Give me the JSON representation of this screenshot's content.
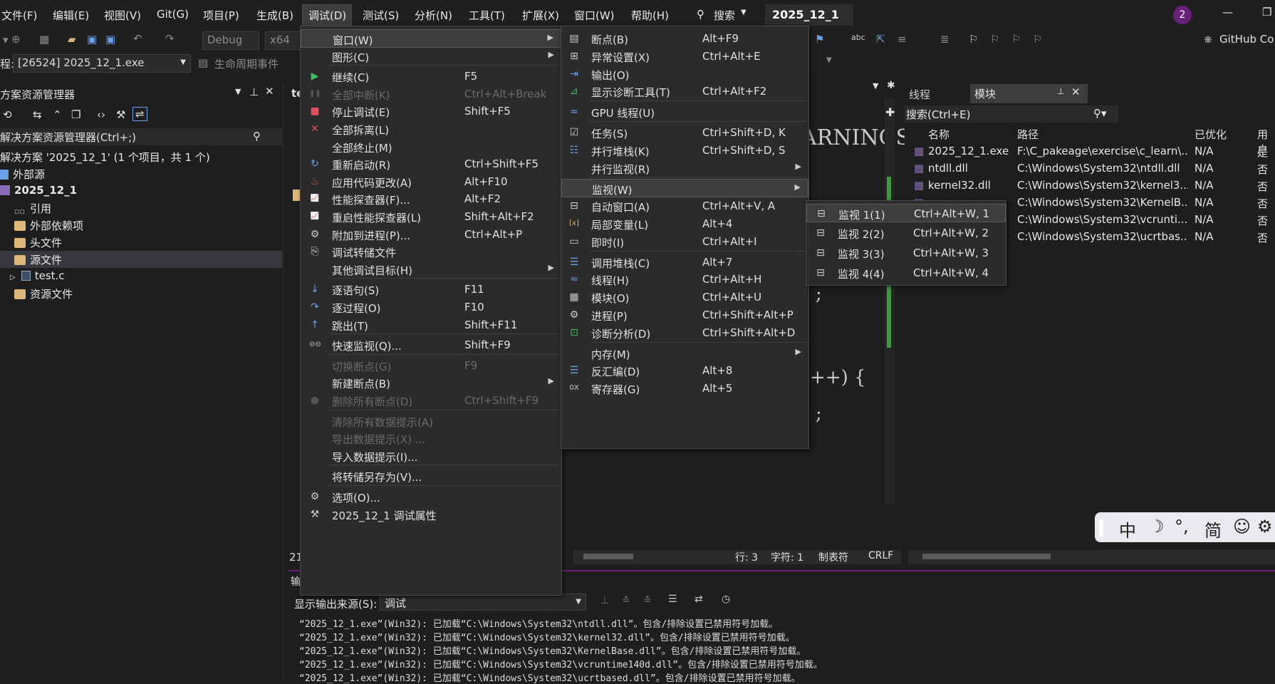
{
  "menubar": {
    "items": [
      "文件(F)",
      "编辑(E)",
      "视图(V)",
      "Git(G)",
      "项目(P)",
      "生成(B)",
      "调试(D)",
      "测试(S)",
      "分析(N)",
      "工具(T)",
      "扩展(X)",
      "窗口(W)",
      "帮助(H)"
    ],
    "search": "搜索",
    "project_title": "2025_12_1",
    "notification_count": "2"
  },
  "toolbar": {
    "config": "Debug",
    "platform": "x64",
    "github": "GitHub Co"
  },
  "toolbar2": {
    "process_label": "程:",
    "process": "[26524] 2025_12_1.exe",
    "lifecycle": "生命周期事件"
  },
  "solution_explorer": {
    "title": "方案资源管理器",
    "search_placeholder": "解决方案资源管理器(Ctrl+;)",
    "items": [
      {
        "label": "解决方案 '2025_12_1' (1 个项目，共 1 个)",
        "indent": 0
      },
      {
        "label": "外部源",
        "indent": 0
      },
      {
        "label": "2025_12_1",
        "indent": 0,
        "bold": true
      },
      {
        "label": "引用",
        "indent": 1
      },
      {
        "label": "外部依赖项",
        "indent": 1
      },
      {
        "label": "头文件",
        "indent": 1
      },
      {
        "label": "源文件",
        "indent": 1,
        "selected": true
      },
      {
        "label": "test.c",
        "indent": 2
      },
      {
        "label": "资源文件",
        "indent": 1
      }
    ]
  },
  "editor": {
    "code_fragments": [
      "ARNINGS",
      ";",
      "++)  {",
      ";"
    ],
    "line_number": "21",
    "tab_fragment": "te"
  },
  "status": {
    "line": "行: 3",
    "char": "字符: 1",
    "tab": "制表符",
    "eol": "CRLF"
  },
  "right_panel": {
    "tabs": [
      "线程",
      "模块"
    ],
    "search_placeholder": "搜索(Ctrl+E)",
    "columns": [
      "名称",
      "路径",
      "已优化",
      "用户"
    ],
    "rows": [
      {
        "name": "2025_12_1.exe",
        "path": "F:\\C_pakeage\\exercise\\c_learn\\...",
        "opt": "N/A",
        "user": "是"
      },
      {
        "name": "ntdll.dll",
        "path": "C:\\Windows\\System32\\ntdll.dll",
        "opt": "N/A",
        "user": "否"
      },
      {
        "name": "kernel32.dll",
        "path": "C:\\Windows\\System32\\kernel3...",
        "opt": "N/A",
        "user": "否"
      },
      {
        "name": "",
        "path": "C:\\Windows\\System32\\KernelB...",
        "opt": "N/A",
        "user": "否"
      },
      {
        "name": "",
        "path": "C:\\Windows\\System32\\vcrunti...",
        "opt": "N/A",
        "user": "否"
      },
      {
        "name": "",
        "path": "C:\\Windows\\System32\\ucrtbas...",
        "opt": "N/A",
        "user": "否"
      }
    ]
  },
  "output": {
    "tab": "输",
    "source_label": "显示输出来源(S):",
    "source_value": "调试",
    "lines": [
      "“2025_12_1.exe”(Win32): 已加载“C:\\Windows\\System32\\ntdll.dll”。包含/排除设置已禁用符号加载。",
      "“2025_12_1.exe”(Win32): 已加载“C:\\Windows\\System32\\kernel32.dll”。包含/排除设置已禁用符号加载。",
      "“2025_12_1.exe”(Win32): 已加载“C:\\Windows\\System32\\KernelBase.dll”。包含/排除设置已禁用符号加载。",
      "“2025_12_1.exe”(Win32): 已加载“C:\\Windows\\System32\\vcruntime140d.dll”。包含/排除设置已禁用符号加载。",
      "“2025_12_1.exe”(Win32): 已加载“C:\\Windows\\System32\\ucrtbased.dll”。包含/排除设置已禁用符号加载。"
    ]
  },
  "debug_menu": [
    {
      "label": "窗口(W)",
      "sc": "",
      "sub": true,
      "icon": "",
      "hl": true
    },
    {
      "label": "图形(C)",
      "sc": "",
      "sub": true,
      "icon": ""
    },
    {
      "sep": true
    },
    {
      "label": "继续(C)",
      "sc": "F5",
      "icon": "play-icon"
    },
    {
      "label": "全部中断(K)",
      "sc": "Ctrl+Alt+Break",
      "icon": "pause-icon",
      "dis": true
    },
    {
      "label": "停止调试(E)",
      "sc": "Shift+F5",
      "icon": "stop-icon"
    },
    {
      "label": "全部拆离(L)",
      "sc": "",
      "icon": "detach-icon"
    },
    {
      "label": "全部终止(M)",
      "sc": "",
      "icon": ""
    },
    {
      "label": "重新启动(R)",
      "sc": "Ctrl+Shift+F5",
      "icon": "restart-icon"
    },
    {
      "label": "应用代码更改(A)",
      "sc": "Alt+F10",
      "icon": "hot-reload-icon"
    },
    {
      "label": "性能探查器(F)...",
      "sc": "Alt+F2",
      "icon": "profiler-icon"
    },
    {
      "label": "重启性能探查器(L)",
      "sc": "Shift+Alt+F2",
      "icon": "profiler-icon"
    },
    {
      "label": "附加到进程(P)...",
      "sc": "Ctrl+Alt+P",
      "icon": "gear-icon"
    },
    {
      "label": "调试转储文件",
      "sc": "",
      "icon": "dump-icon"
    },
    {
      "label": "其他调试目标(H)",
      "sc": "",
      "sub": true,
      "icon": ""
    },
    {
      "sep": true
    },
    {
      "label": "逐语句(S)",
      "sc": "F11",
      "icon": "step-into-icon"
    },
    {
      "label": "逐过程(O)",
      "sc": "F10",
      "icon": "step-over-icon"
    },
    {
      "label": "跳出(T)",
      "sc": "Shift+F11",
      "icon": "step-out-icon"
    },
    {
      "sep": true
    },
    {
      "label": "快速监视(Q)...",
      "sc": "Shift+F9",
      "icon": "glasses-icon"
    },
    {
      "sep": true
    },
    {
      "label": "切换断点(G)",
      "sc": "F9",
      "icon": "",
      "dis": true
    },
    {
      "label": "新建断点(B)",
      "sc": "",
      "sub": true,
      "icon": ""
    },
    {
      "label": "删除所有断点(D)",
      "sc": "Ctrl+Shift+F9",
      "icon": "delete-breakpoints-icon",
      "dis": true
    },
    {
      "sep": true
    },
    {
      "label": "清除所有数据提示(A)",
      "sc": "",
      "icon": "",
      "dis": true
    },
    {
      "label": "导出数据提示(X) ...",
      "sc": "",
      "icon": "",
      "dis": true
    },
    {
      "label": "导入数据提示(I)...",
      "sc": "",
      "icon": ""
    },
    {
      "sep": true
    },
    {
      "label": "将转储另存为(V)...",
      "sc": "",
      "icon": ""
    },
    {
      "sep": true
    },
    {
      "label": "选项(O)...",
      "sc": "",
      "icon": "gear-icon"
    },
    {
      "label": "2025_12_1 调试属性",
      "sc": "",
      "icon": "wrench-icon"
    }
  ],
  "window_menu": [
    {
      "label": "断点(B)",
      "sc": "Alt+F9",
      "icon": "breakpoints-icon"
    },
    {
      "label": "异常设置(X)",
      "sc": "Ctrl+Alt+E",
      "icon": "exception-icon"
    },
    {
      "label": "输出(O)",
      "sc": "",
      "icon": "output-icon"
    },
    {
      "label": "显示诊断工具(T)",
      "sc": "Ctrl+Alt+F2",
      "icon": "diagnostics-icon"
    },
    {
      "sep": true
    },
    {
      "label": "GPU 线程(U)",
      "sc": "",
      "icon": "gpu-threads-icon"
    },
    {
      "sep": true
    },
    {
      "label": "任务(S)",
      "sc": "Ctrl+Shift+D, K",
      "icon": "tasks-icon"
    },
    {
      "label": "并行堆栈(K)",
      "sc": "Ctrl+Shift+D, S",
      "icon": "parallel-stacks-icon"
    },
    {
      "label": "并行监视(R)",
      "sc": "",
      "sub": true,
      "icon": ""
    },
    {
      "sep": true
    },
    {
      "label": "监视(W)",
      "sc": "",
      "sub": true,
      "icon": "",
      "hl": true
    },
    {
      "label": "自动窗口(A)",
      "sc": "Ctrl+Alt+V, A",
      "icon": "autos-icon"
    },
    {
      "label": "局部变量(L)",
      "sc": "Alt+4",
      "icon": "locals-icon"
    },
    {
      "label": "即时(I)",
      "sc": "Ctrl+Alt+I",
      "icon": "immediate-icon"
    },
    {
      "sep": true
    },
    {
      "label": "调用堆栈(C)",
      "sc": "Alt+7",
      "icon": "call-stack-icon"
    },
    {
      "label": "线程(H)",
      "sc": "Ctrl+Alt+H",
      "icon": "threads-icon"
    },
    {
      "label": "模块(O)",
      "sc": "Ctrl+Alt+U",
      "icon": "modules-icon"
    },
    {
      "label": "进程(P)",
      "sc": "Ctrl+Shift+Alt+P",
      "icon": "processes-icon"
    },
    {
      "label": "诊断分析(D)",
      "sc": "Ctrl+Shift+Alt+D",
      "icon": "diagnostic-analysis-icon"
    },
    {
      "sep": true
    },
    {
      "label": "内存(M)",
      "sc": "",
      "sub": true,
      "icon": ""
    },
    {
      "label": "反汇编(D)",
      "sc": "Alt+8",
      "icon": "disassembly-icon"
    },
    {
      "label": "寄存器(G)",
      "sc": "Alt+5",
      "icon": "registers-icon"
    }
  ],
  "watch_menu": [
    {
      "label": "监视 1(1)",
      "sc": "Ctrl+Alt+W, 1",
      "hl": true
    },
    {
      "label": "监视 2(2)",
      "sc": "Ctrl+Alt+W, 2"
    },
    {
      "label": "监视 3(3)",
      "sc": "Ctrl+Alt+W, 3"
    },
    {
      "label": "监视 4(4)",
      "sc": "Ctrl+Alt+W, 4"
    }
  ],
  "ime": [
    "中",
    "☽",
    "°,",
    "简",
    "☺",
    "⚙"
  ]
}
